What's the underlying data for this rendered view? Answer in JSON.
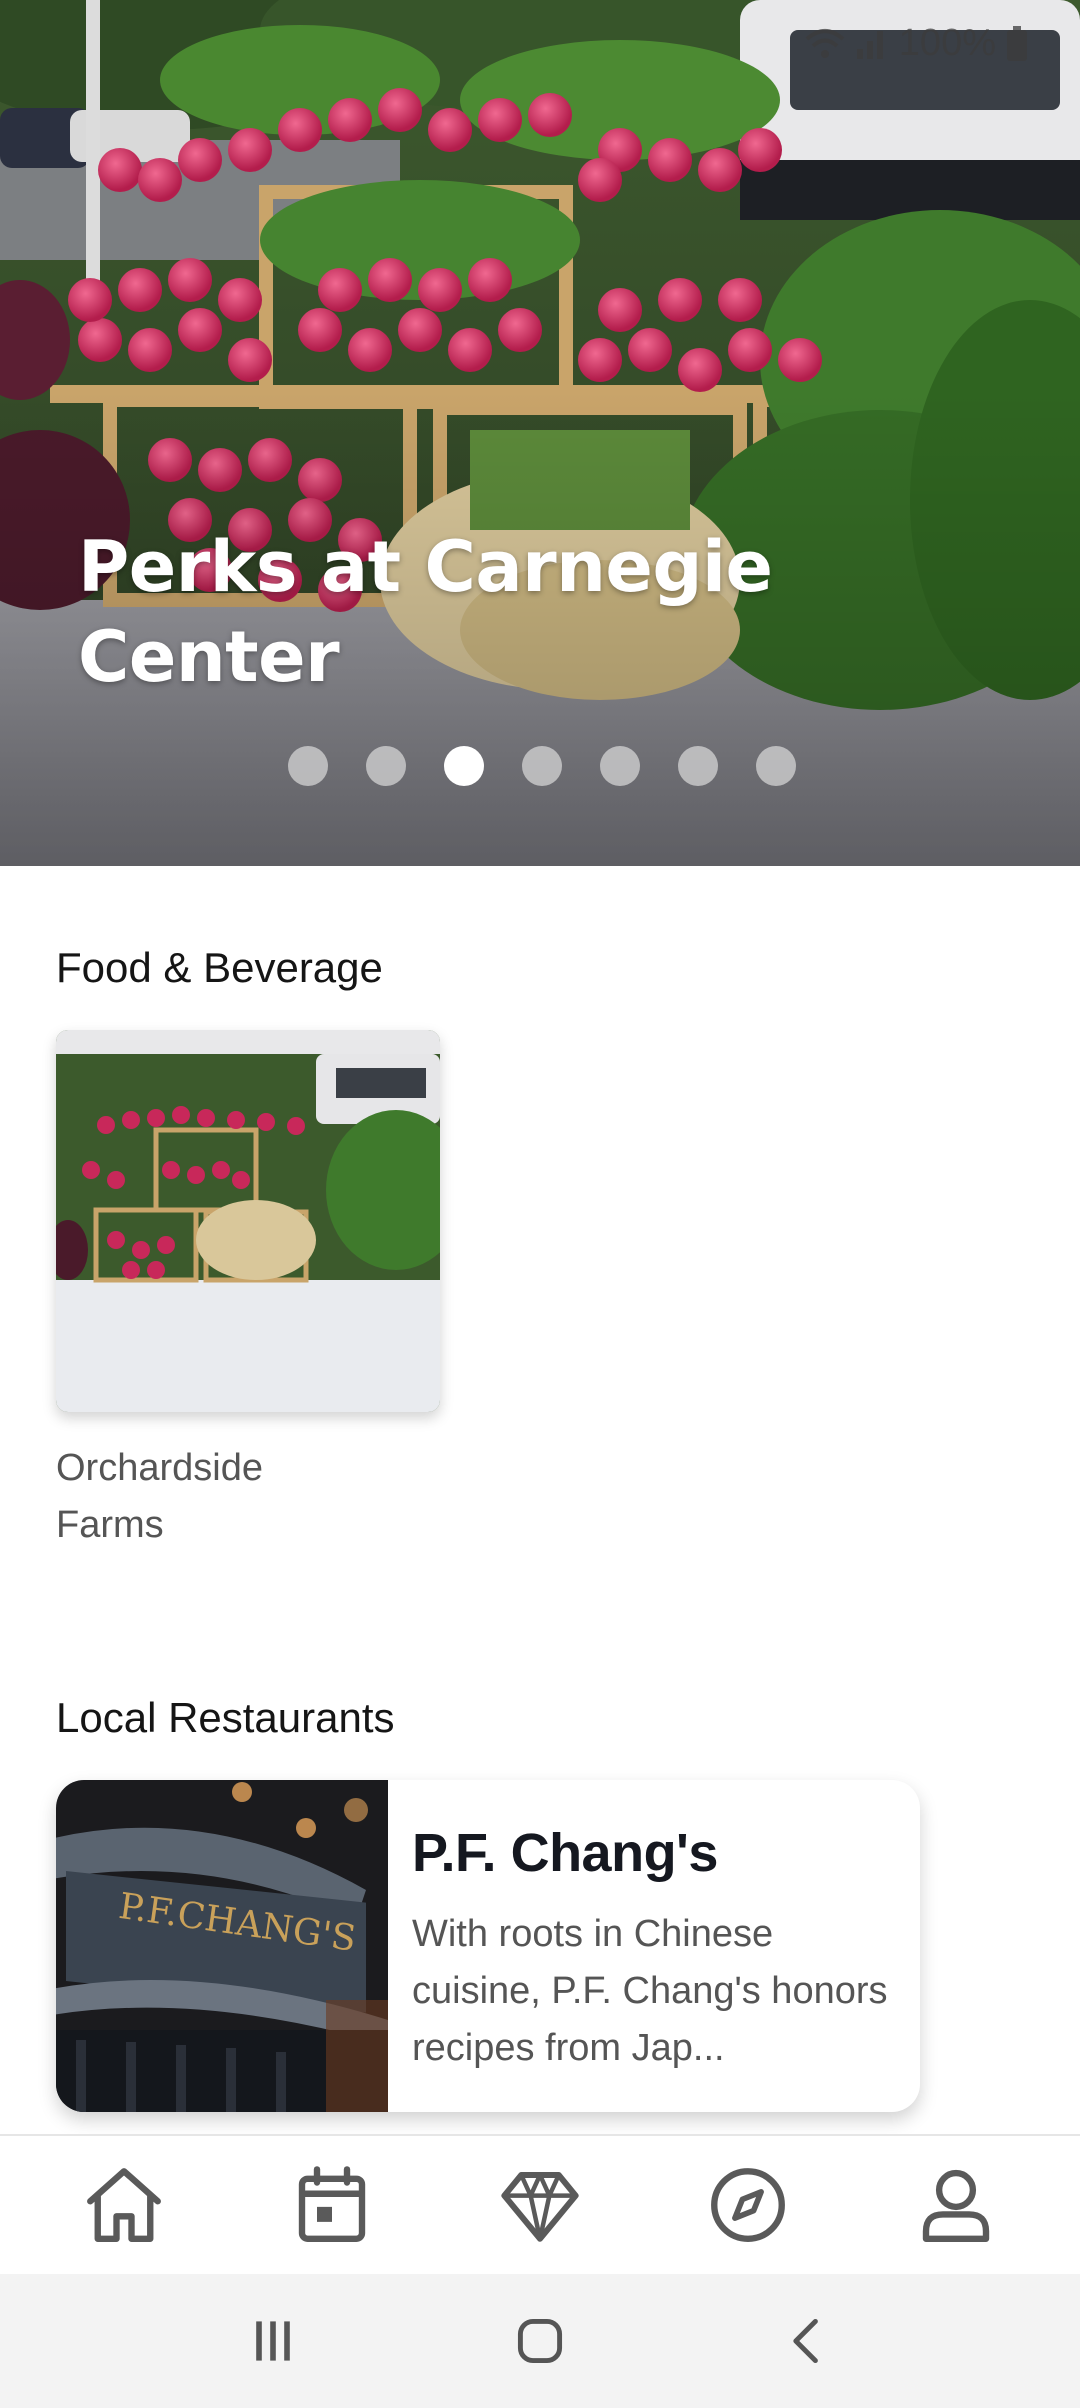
{
  "hero": {
    "title": "Perks at Carnegie Center",
    "carousel_dots": 7,
    "active_dot": 3
  },
  "status_bar": {
    "battery": "100%"
  },
  "sections": {
    "food_beverage": {
      "title": "Food & Beverage",
      "items": [
        {
          "name": "Orchardside Farms"
        }
      ]
    },
    "local_restaurants": {
      "title": "Local Restaurants",
      "items": [
        {
          "name": "P.F. Chang's",
          "description": "With roots in Chinese cuisine, P.F. Chang's honors recipes from Jap..."
        }
      ]
    }
  },
  "bottom_nav": {
    "items": [
      "home-icon",
      "calendar-icon",
      "diamond-icon",
      "compass-icon",
      "profile-icon"
    ],
    "icon_color": "#5a5a5a"
  },
  "system_nav": {
    "items": [
      "recents-icon",
      "home-button-icon",
      "back-icon"
    ]
  },
  "colors": {
    "radish": "#c8285a",
    "greens": "#3f7a2c",
    "crate": "#c9a46a"
  }
}
